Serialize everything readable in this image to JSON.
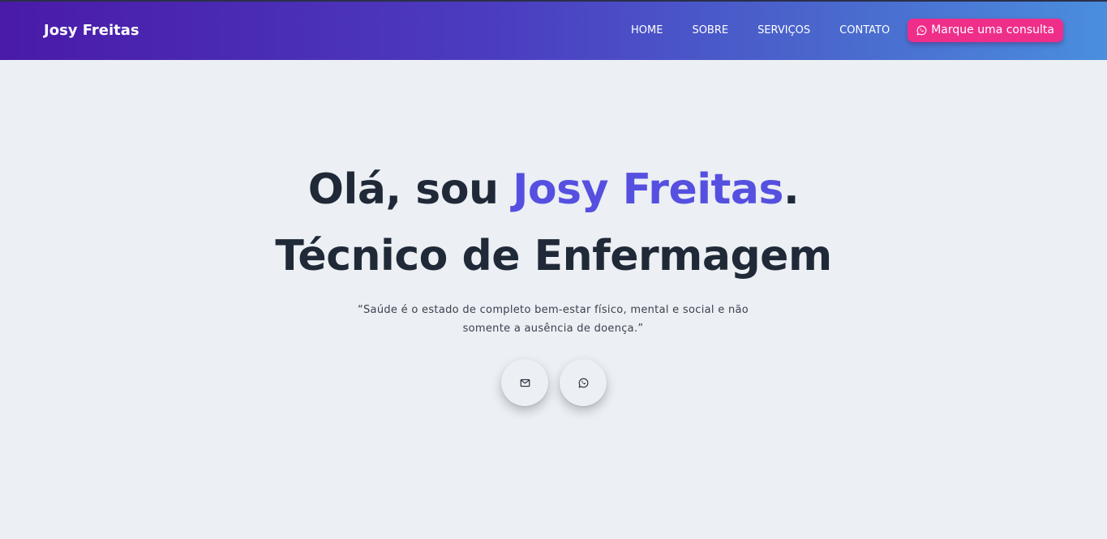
{
  "header": {
    "brand": "Josy Freitas",
    "nav": [
      {
        "label": "HOME"
      },
      {
        "label": "SOBRE"
      },
      {
        "label": "SERVIÇOS"
      },
      {
        "label": "CONTATO"
      }
    ],
    "cta_label": "Marque uma consulta",
    "cta_icon": "whatsapp-icon",
    "cta_color": "#ef2e8a"
  },
  "hero": {
    "greeting_prefix": "Olá, sou ",
    "name": "Josy Freitas",
    "greeting_suffix": ".",
    "title": "Técnico de Enfermagem",
    "quote": "“Saúde é o estado de completo bem-estar físico, mental e social e não somente a ausência de doença.”",
    "accent_color": "#5550e0",
    "buttons": [
      {
        "icon": "mail-icon"
      },
      {
        "icon": "whatsapp-icon"
      }
    ]
  }
}
